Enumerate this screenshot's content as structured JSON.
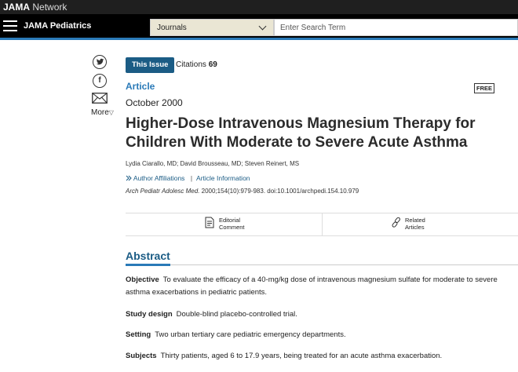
{
  "header": {
    "brand_bold": "JAMA",
    "brand_rest": "Network",
    "journal": "JAMA Pediatrics",
    "journals_select": "Journals",
    "search_placeholder": "Enter Search Term"
  },
  "share": {
    "twitter": "twitter-icon",
    "facebook": "facebook-icon",
    "email": "email-icon",
    "more_label": "More",
    "more_arrow": "▽"
  },
  "article": {
    "this_issue": "This Issue",
    "citations_label": "Citations",
    "citations_count": "69",
    "type": "Article",
    "free": "FREE",
    "date": "October 2000",
    "title": "Higher-Dose Intravenous Magnesium Therapy for Children With Moderate to Severe Acute Asthma",
    "authors": "Lydia Ciarallo, MD; David Brousseau, MD; Steven Reinert, MS",
    "author_affiliations": "Author Affiliations",
    "article_information": "Article Information",
    "citation_journal": "Arch Pediatr Adolesc Med.",
    "citation_rest": " 2000;154(10):979-983. doi:10.1001/archpedi.154.10.979"
  },
  "tools": {
    "editorial_line1": "Editorial",
    "editorial_line2": "Comment",
    "related_line1": "Related",
    "related_line2": "Articles"
  },
  "abstract": {
    "heading": "Abstract",
    "sections": [
      {
        "label": "Objective",
        "text": "To evaluate the efficacy of a 40-mg/kg dose of intravenous magnesium sulfate for moderate to severe asthma exacerbations in pediatric patients."
      },
      {
        "label": "Study design",
        "text": "Double-blind placebo-controlled trial."
      },
      {
        "label": "Setting",
        "text": "Two urban tertiary care pediatric emergency departments."
      },
      {
        "label": "Subjects",
        "text": "Thirty patients, aged 6 to 17.9 years, being treated for an acute asthma exacerbation."
      }
    ]
  }
}
